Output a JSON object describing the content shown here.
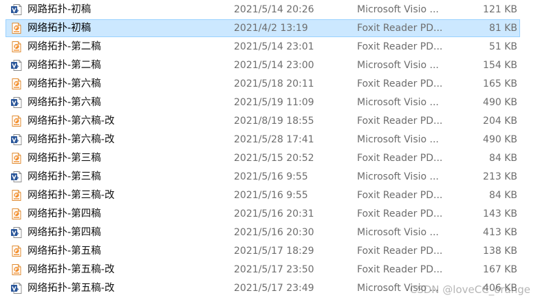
{
  "files": [
    {
      "name": "网路拓扑-初稿",
      "date": "2021/5/14 20:26",
      "type": "Microsoft Visio ...",
      "size": "121 KB",
      "icon": "visio-file-icon",
      "selected": false
    },
    {
      "name": "网络拓扑-初稿",
      "date": "2021/4/2 13:19",
      "type": "Foxit Reader PD...",
      "size": "81 KB",
      "icon": "pdf-file-icon",
      "selected": true
    },
    {
      "name": "网络拓扑-第二稿",
      "date": "2021/5/14 23:01",
      "type": "Foxit Reader PD...",
      "size": "51 KB",
      "icon": "pdf-file-icon",
      "selected": false
    },
    {
      "name": "网络拓扑-第二稿",
      "date": "2021/5/14 23:00",
      "type": "Microsoft Visio ...",
      "size": "154 KB",
      "icon": "visio-file-icon",
      "selected": false
    },
    {
      "name": "网络拓扑-第六稿",
      "date": "2021/5/18 20:11",
      "type": "Foxit Reader PD...",
      "size": "165 KB",
      "icon": "pdf-file-icon",
      "selected": false
    },
    {
      "name": "网络拓扑-第六稿",
      "date": "2021/5/19 11:09",
      "type": "Microsoft Visio ...",
      "size": "490 KB",
      "icon": "visio-file-icon",
      "selected": false
    },
    {
      "name": "网络拓扑-第六稿-改",
      "date": "2021/8/19 18:55",
      "type": "Foxit Reader PD...",
      "size": "204 KB",
      "icon": "pdf-file-icon",
      "selected": false
    },
    {
      "name": "网络拓扑-第六稿-改",
      "date": "2021/5/28 17:41",
      "type": "Microsoft Visio ...",
      "size": "490 KB",
      "icon": "visio-file-icon",
      "selected": false
    },
    {
      "name": "网络拓扑-第三稿",
      "date": "2021/5/15 20:52",
      "type": "Foxit Reader PD...",
      "size": "84 KB",
      "icon": "pdf-file-icon",
      "selected": false
    },
    {
      "name": "网络拓扑-第三稿",
      "date": "2021/5/16 9:55",
      "type": "Microsoft Visio ...",
      "size": "213 KB",
      "icon": "visio-file-icon",
      "selected": false
    },
    {
      "name": "网络拓扑-第三稿-改",
      "date": "2021/5/16 9:55",
      "type": "Foxit Reader PD...",
      "size": "84 KB",
      "icon": "pdf-file-icon",
      "selected": false
    },
    {
      "name": "网络拓扑-第四稿",
      "date": "2021/5/16 20:31",
      "type": "Foxit Reader PD...",
      "size": "143 KB",
      "icon": "pdf-file-icon",
      "selected": false
    },
    {
      "name": "网络拓扑-第四稿",
      "date": "2021/5/16 20:30",
      "type": "Microsoft Visio ...",
      "size": "413 KB",
      "icon": "visio-file-icon",
      "selected": false
    },
    {
      "name": "网络拓扑-第五稿",
      "date": "2021/5/17 18:29",
      "type": "Foxit Reader PD...",
      "size": "138 KB",
      "icon": "pdf-file-icon",
      "selected": false
    },
    {
      "name": "网络拓扑-第五稿-改",
      "date": "2021/5/17 23:50",
      "type": "Foxit Reader PD...",
      "size": "167 KB",
      "icon": "pdf-file-icon",
      "selected": false
    },
    {
      "name": "网络拓扑-第五稿-改",
      "date": "2021/5/17 23:49",
      "type": "Microsoft Visio ...",
      "size": "406 KB",
      "icon": "visio-file-icon",
      "selected": false
    }
  ],
  "watermark": "CSDN @loveCC_orange",
  "colors": {
    "selection_fill": "#cce8ff",
    "selection_border": "#99d1ff",
    "visio_blue": "#2b579a",
    "pdf_orange": "#f28c28"
  }
}
